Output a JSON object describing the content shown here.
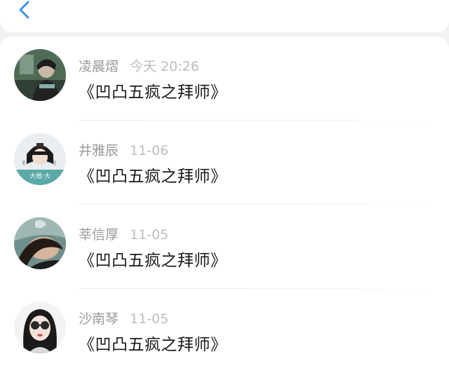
{
  "header": {
    "back_icon": "chevron-left-icon",
    "accent_color": "#3b8ff0"
  },
  "messages": [
    {
      "name": "凌晨熠",
      "time": "今天 20:26",
      "text": "《凹凸五疯之拜师》"
    },
    {
      "name": "井雅辰",
      "time": "11-06",
      "text": "《凹凸五疯之拜师》",
      "avatar_caption": "大他·大"
    },
    {
      "name": "莘信厚",
      "time": "11-05",
      "text": "《凹凸五疯之拜师》"
    },
    {
      "name": "沙南琴",
      "time": "11-05",
      "text": "《凹凸五疯之拜师》"
    }
  ]
}
